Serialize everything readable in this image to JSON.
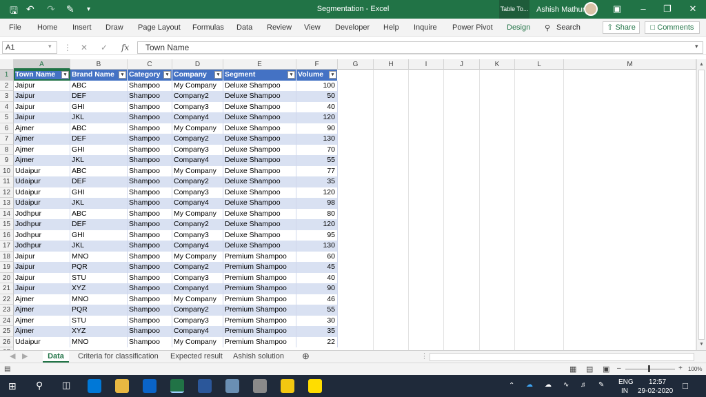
{
  "window": {
    "title": "Segmentation  -  Excel",
    "context_tab": "Table To...",
    "user": "Ashish Mathur"
  },
  "quick_access": {
    "undo_icon": "undo-icon",
    "redo_icon": "redo-icon",
    "save_icon": "save-icon",
    "customize_icon": "customize-icon"
  },
  "menu": [
    "File",
    "Home",
    "Insert",
    "Draw",
    "Page Layout",
    "Formulas",
    "Data",
    "Review",
    "View",
    "Developer",
    "Help",
    "Inquire",
    "Power Pivot",
    "Design",
    "Search"
  ],
  "share_label": "Share",
  "comments_label": "Comments",
  "name_box": "A1",
  "formula": "Town Name",
  "columns": [
    "A",
    "B",
    "C",
    "D",
    "E",
    "F",
    "G",
    "H",
    "I",
    "J",
    "K",
    "L",
    "M"
  ],
  "headers": [
    "Town Name",
    "Brand Name",
    "Category",
    "Company",
    "Segment",
    "Volume"
  ],
  "rows": [
    [
      "Jaipur",
      "ABC",
      "Shampoo",
      "My Company",
      "Deluxe Shampoo",
      "100"
    ],
    [
      "Jaipur",
      "DEF",
      "Shampoo",
      "Company2",
      "Deluxe Shampoo",
      "50"
    ],
    [
      "Jaipur",
      "GHI",
      "Shampoo",
      "Company3",
      "Deluxe Shampoo",
      "40"
    ],
    [
      "Jaipur",
      "JKL",
      "Shampoo",
      "Company4",
      "Deluxe Shampoo",
      "120"
    ],
    [
      "Ajmer",
      "ABC",
      "Shampoo",
      "My Company",
      "Deluxe Shampoo",
      "90"
    ],
    [
      "Ajmer",
      "DEF",
      "Shampoo",
      "Company2",
      "Deluxe Shampoo",
      "130"
    ],
    [
      "Ajmer",
      "GHI",
      "Shampoo",
      "Company3",
      "Deluxe Shampoo",
      "70"
    ],
    [
      "Ajmer",
      "JKL",
      "Shampoo",
      "Company4",
      "Deluxe Shampoo",
      "55"
    ],
    [
      "Udaipur",
      "ABC",
      "Shampoo",
      "My Company",
      "Deluxe Shampoo",
      "77"
    ],
    [
      "Udaipur",
      "DEF",
      "Shampoo",
      "Company2",
      "Deluxe Shampoo",
      "35"
    ],
    [
      "Udaipur",
      "GHI",
      "Shampoo",
      "Company3",
      "Deluxe Shampoo",
      "120"
    ],
    [
      "Udaipur",
      "JKL",
      "Shampoo",
      "Company4",
      "Deluxe Shampoo",
      "98"
    ],
    [
      "Jodhpur",
      "ABC",
      "Shampoo",
      "My Company",
      "Deluxe Shampoo",
      "80"
    ],
    [
      "Jodhpur",
      "DEF",
      "Shampoo",
      "Company2",
      "Deluxe Shampoo",
      "120"
    ],
    [
      "Jodhpur",
      "GHI",
      "Shampoo",
      "Company3",
      "Deluxe Shampoo",
      "95"
    ],
    [
      "Jodhpur",
      "JKL",
      "Shampoo",
      "Company4",
      "Deluxe Shampoo",
      "130"
    ],
    [
      "Jaipur",
      "MNO",
      "Shampoo",
      "My Company",
      "Premium Shampoo",
      "60"
    ],
    [
      "Jaipur",
      "PQR",
      "Shampoo",
      "Company2",
      "Premium Shampoo",
      "45"
    ],
    [
      "Jaipur",
      "STU",
      "Shampoo",
      "Company3",
      "Premium Shampoo",
      "40"
    ],
    [
      "Jaipur",
      "XYZ",
      "Shampoo",
      "Company4",
      "Premium Shampoo",
      "90"
    ],
    [
      "Ajmer",
      "MNO",
      "Shampoo",
      "My Company",
      "Premium Shampoo",
      "46"
    ],
    [
      "Ajmer",
      "PQR",
      "Shampoo",
      "Company2",
      "Premium Shampoo",
      "55"
    ],
    [
      "Ajmer",
      "STU",
      "Shampoo",
      "Company3",
      "Premium Shampoo",
      "30"
    ],
    [
      "Ajmer",
      "XYZ",
      "Shampoo",
      "Company4",
      "Premium Shampoo",
      "35"
    ],
    [
      "Udaipur",
      "MNO",
      "Shampoo",
      "My Company",
      "Premium Shampoo",
      "22"
    ]
  ],
  "sheets": [
    "Data",
    "Criteria for classification",
    "Expected result",
    "Ashish solution"
  ],
  "zoom": "100%",
  "taskbar": {
    "lang": "ENG",
    "region": "IN",
    "time": "12:57",
    "date": "29-02-2020"
  },
  "colors": {
    "excel_green": "#217346",
    "table_header": "#4472c4",
    "table_band": "#d9e1f2"
  }
}
